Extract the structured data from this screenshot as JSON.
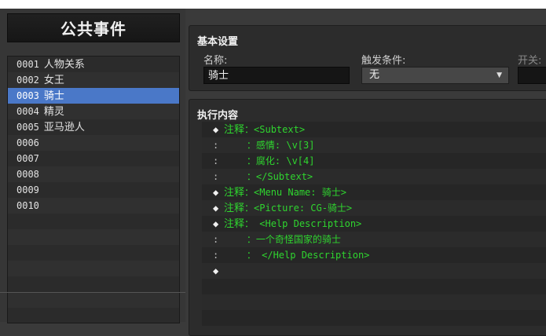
{
  "left": {
    "title": "公共事件",
    "events": [
      {
        "num": "0001",
        "name": "人物关系"
      },
      {
        "num": "0002",
        "name": "女王"
      },
      {
        "num": "0003",
        "name": "骑士"
      },
      {
        "num": "0004",
        "name": "精灵"
      },
      {
        "num": "0005",
        "name": "亚马逊人"
      },
      {
        "num": "0006",
        "name": ""
      },
      {
        "num": "0007",
        "name": ""
      },
      {
        "num": "0008",
        "name": ""
      },
      {
        "num": "0009",
        "name": ""
      },
      {
        "num": "0010",
        "name": ""
      }
    ],
    "selected_index": 2
  },
  "basic": {
    "title": "基本设置",
    "name_label": "名称:",
    "name_value": "骑士",
    "trigger_label": "触发条件:",
    "trigger_value": "无",
    "switch_label": "开关:"
  },
  "exec": {
    "title": "执行内容",
    "commands": [
      {
        "type": "head",
        "head": "注释",
        "text": "：<Subtext>"
      },
      {
        "type": "cont",
        "text": "：感情: \\v[3]"
      },
      {
        "type": "cont",
        "text": "：腐化: \\v[4]"
      },
      {
        "type": "cont",
        "text": "：</Subtext>"
      },
      {
        "type": "head",
        "head": "注释",
        "text": "：<Menu Name: 骑士>"
      },
      {
        "type": "head",
        "head": "注释",
        "text": "：<Picture: CG-骑士>"
      },
      {
        "type": "head",
        "head": "注释",
        "text": "：  <Help Description>"
      },
      {
        "type": "cont",
        "text": "：一个奇怪国家的骑士"
      },
      {
        "type": "cont",
        "text": "：  </Help Description>"
      },
      {
        "type": "empty",
        "text": ""
      }
    ]
  },
  "colors": {
    "selection": "#4a78c8",
    "comment_green": "#2fd52f"
  }
}
